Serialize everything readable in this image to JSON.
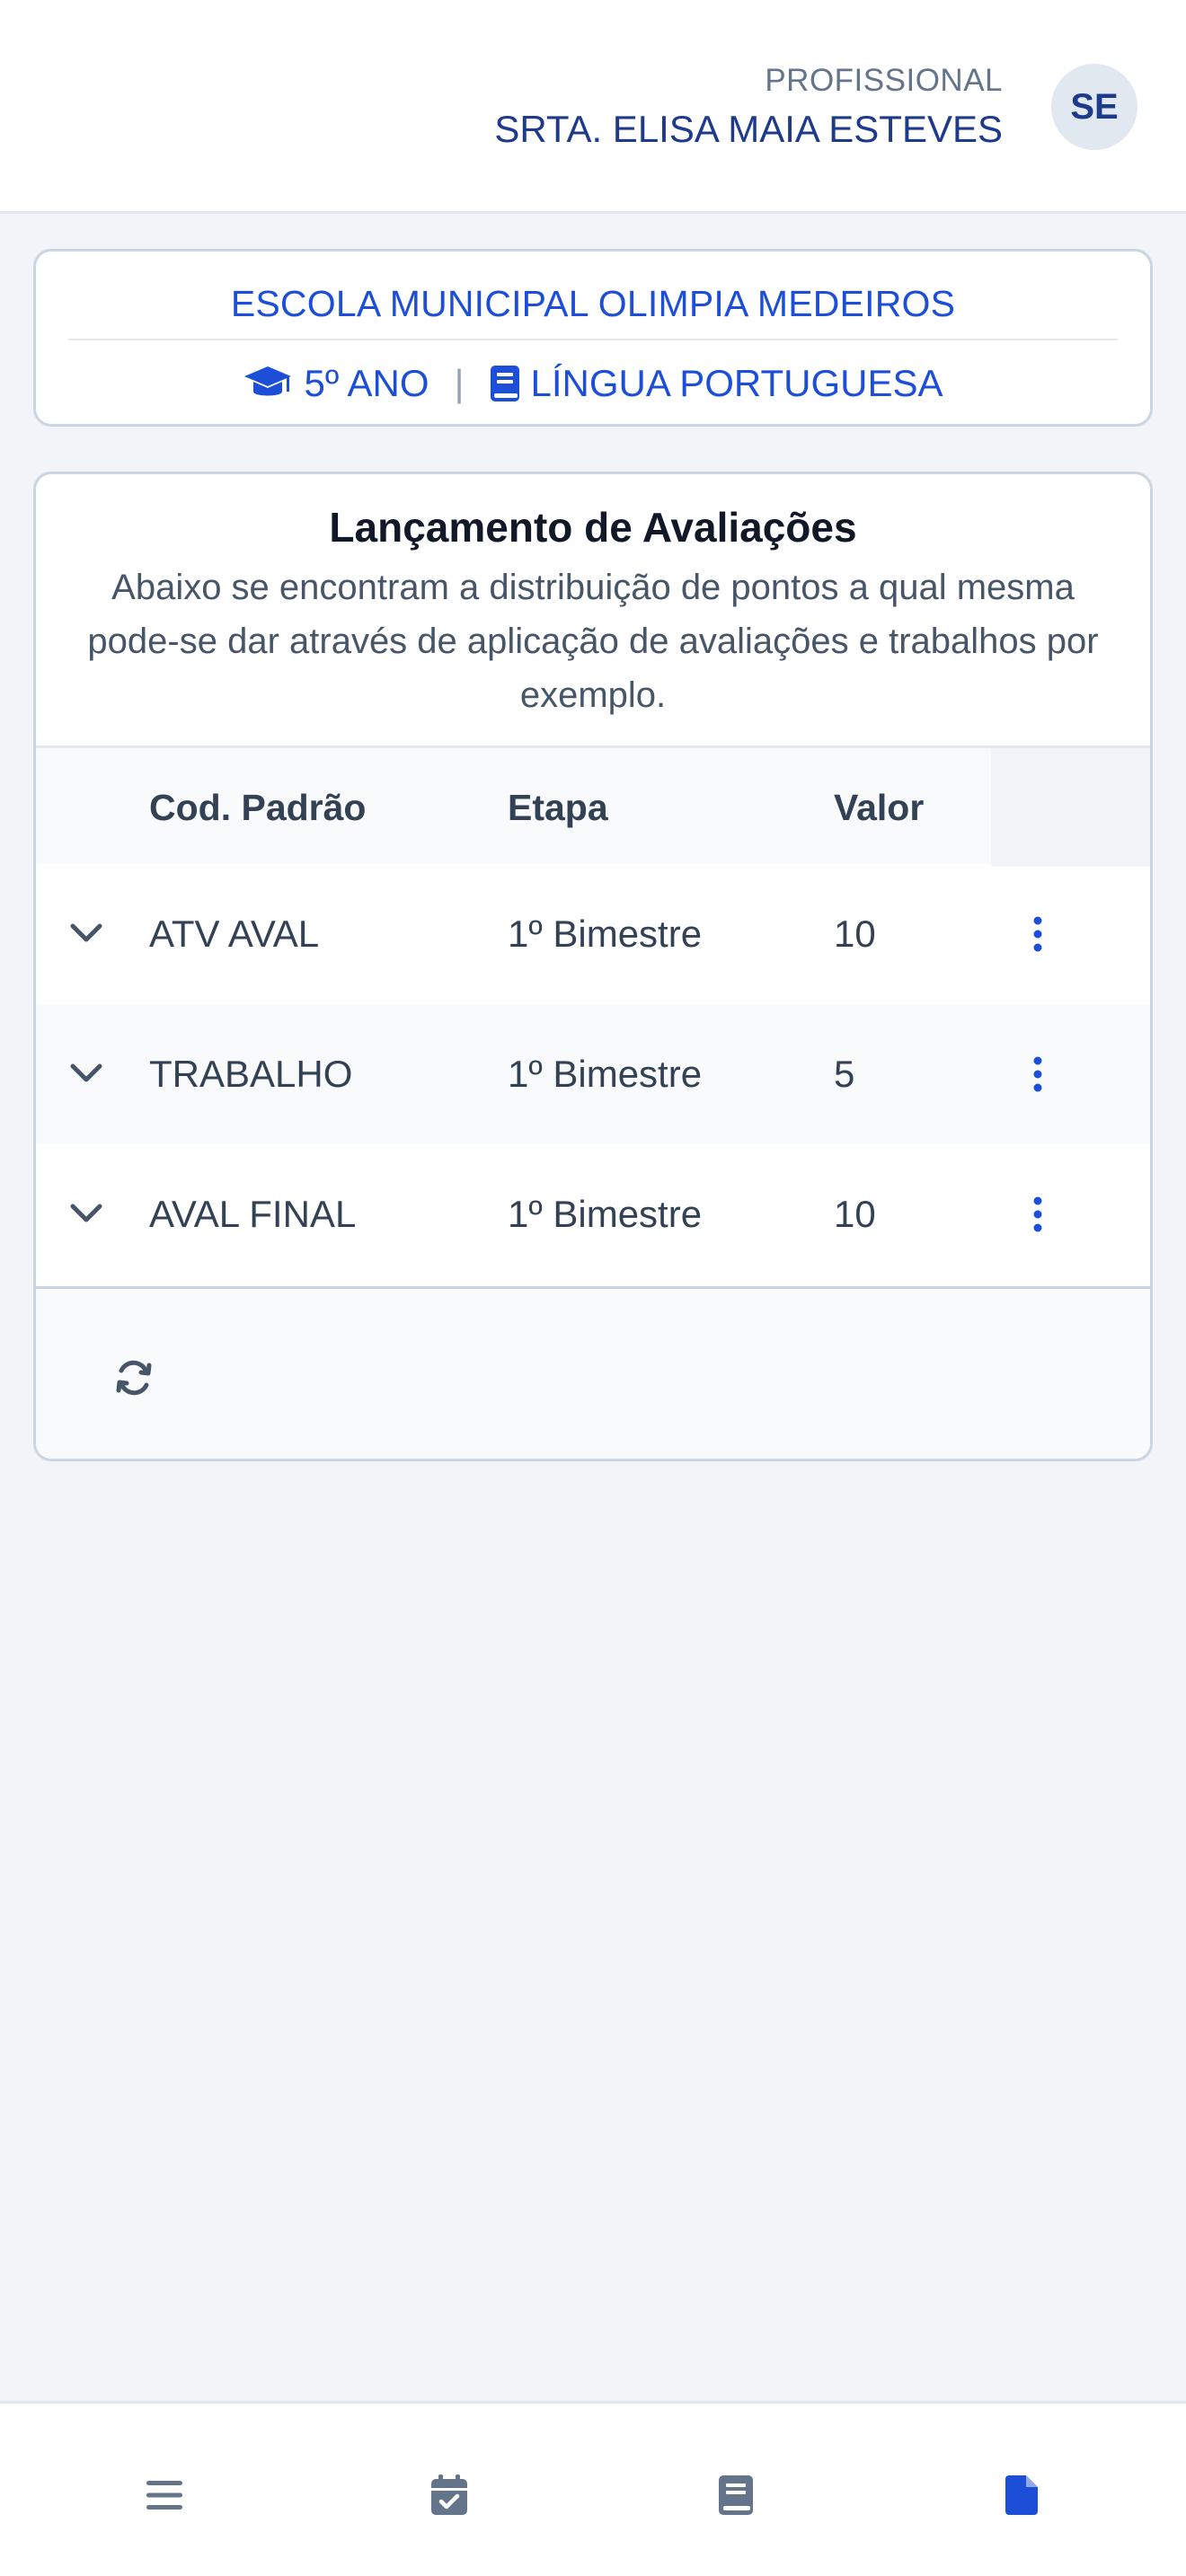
{
  "header": {
    "role_label": "PROFISSIONAL",
    "user_name": "SRTA. ELISA MAIA ESTEVES",
    "avatar_initials": "SE"
  },
  "class_card": {
    "school_name": "ESCOLA MUNICIPAL OLIMPIA MEDEIROS",
    "grade_icon": "graduation-cap-icon",
    "grade": "5º ANO",
    "separator": "|",
    "subject_icon": "book-icon",
    "subject": "LÍNGUA PORTUGUESA"
  },
  "assessments": {
    "title": "Lançamento de Avaliações",
    "description": "Abaixo se encontram a distribuição de pontos a qual mesma pode-se dar através de aplicação de avaliações e trabalhos por exemplo.",
    "columns": [
      "Cod. Padrão",
      "Etapa",
      "Valor"
    ],
    "rows": [
      {
        "code": "ATV AVAL",
        "stage": "1º Bimestre",
        "value": "10"
      },
      {
        "code": "TRABALHO",
        "stage": "1º Bimestre",
        "value": "5"
      },
      {
        "code": "AVAL FINAL",
        "stage": "1º Bimestre",
        "value": "10"
      }
    ],
    "footer_icon": "refresh-icon"
  },
  "bottom_nav": {
    "items": [
      {
        "icon": "menu-icon",
        "active": false
      },
      {
        "icon": "calendar-check-icon",
        "active": false
      },
      {
        "icon": "book-icon",
        "active": false
      },
      {
        "icon": "file-icon",
        "active": true
      }
    ]
  },
  "colors": {
    "accent": "#1d4ed8",
    "nav_inactive": "#64748b",
    "user_name": "#1e3a8a",
    "background": "#f1f4f9"
  }
}
